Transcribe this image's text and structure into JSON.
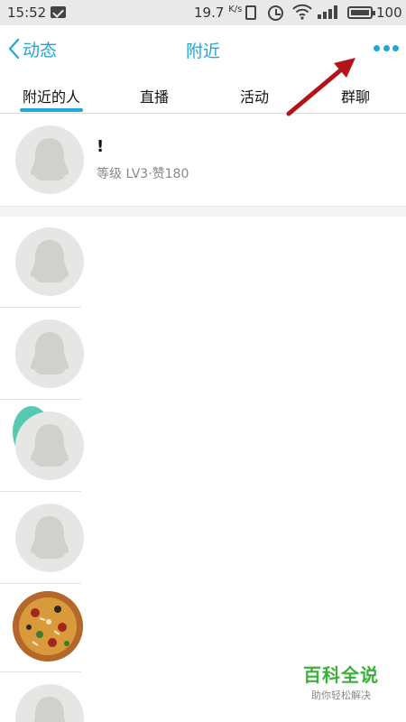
{
  "status_bar": {
    "time": "15:52",
    "speed": "19.7",
    "speed_unit": "K/s",
    "battery": "100"
  },
  "nav": {
    "back_label": "动态",
    "title": "附近",
    "accent_color": "#1fa7d6"
  },
  "tabs": [
    {
      "label": "附近的人",
      "active": true
    },
    {
      "label": "直播",
      "active": false
    },
    {
      "label": "活动",
      "active": false
    },
    {
      "label": "群聊",
      "active": false
    }
  ],
  "people": [
    {
      "name": "!",
      "subtitle": "等级 LV3·赞180",
      "avatar": "default-penguin"
    },
    {
      "avatar": "default-penguin"
    },
    {
      "avatar": "default-penguin"
    },
    {
      "avatar": "default-penguin"
    },
    {
      "avatar": "default-penguin"
    },
    {
      "avatar": "pizza-photo"
    },
    {
      "avatar": "default-penguin"
    }
  ],
  "watermark": {
    "title": "百科全说",
    "subtitle": "助你轻松解决"
  }
}
